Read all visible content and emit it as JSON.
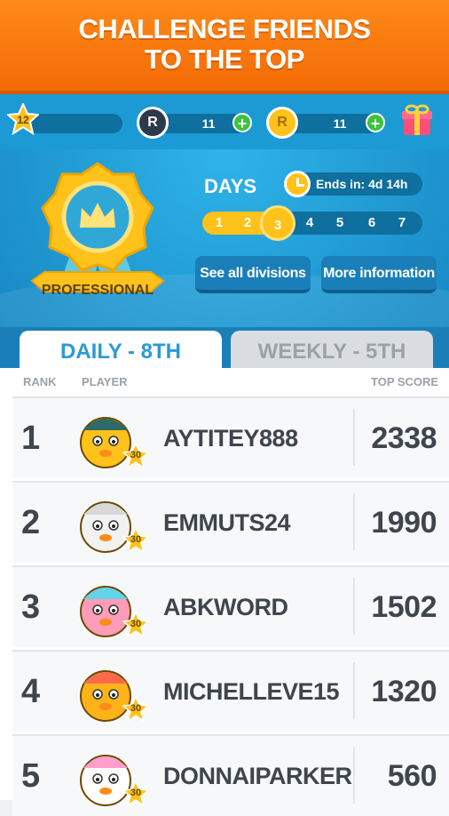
{
  "banner": {
    "line1": "CHALLENGE FRIENDS",
    "line2": "TO THE TOP"
  },
  "topbar": {
    "level": "12",
    "xp_value": "",
    "tokens_icon": "R",
    "tokens_value": "11",
    "coins_icon": "R",
    "coins_value": "11"
  },
  "division": {
    "badge_label": "PROFESSIONAL"
  },
  "days": {
    "title": "DAYS",
    "ends_in": "Ends in: 4d 14h",
    "items": [
      "1",
      "2",
      "3",
      "4",
      "5",
      "6",
      "7"
    ],
    "current": 3
  },
  "buttons": {
    "see_all": "See all divisions",
    "more_info": "More information"
  },
  "tabs": {
    "daily": "DAILY - 8TH",
    "weekly": "WEEKLY - 5TH"
  },
  "columns": {
    "rank": "RANK",
    "player": "PLAYER",
    "score": "TOP SCORE"
  },
  "rows": [
    {
      "rank": "1",
      "name": "AYTITEY888",
      "score": "2338",
      "level": "30"
    },
    {
      "rank": "2",
      "name": "EMMUTS24",
      "score": "1990",
      "level": "30"
    },
    {
      "rank": "3",
      "name": "ABKWORD",
      "score": "1502",
      "level": "30"
    },
    {
      "rank": "4",
      "name": "MICHELLEVE15",
      "score": "1320",
      "level": "30"
    },
    {
      "rank": "5",
      "name": "DONNAIPARKER",
      "score": "560",
      "level": "30"
    }
  ],
  "colors": {
    "banner": "#f26a05",
    "accent": "#2a9ad6",
    "gold": "#ffc21a",
    "plus": "#3cc23c"
  }
}
